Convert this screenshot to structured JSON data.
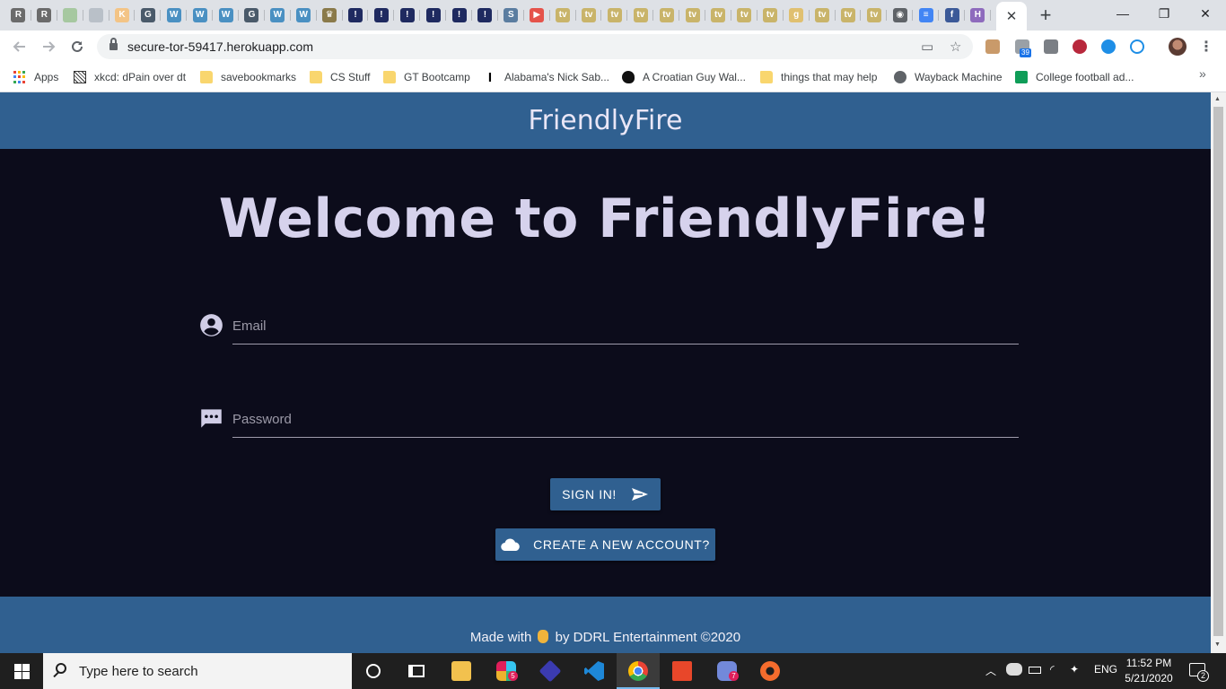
{
  "browser": {
    "tabs": [
      {
        "icon": "r-circle-icon",
        "glyph": "R",
        "color": "#6b6b6b"
      },
      {
        "icon": "r-circle-icon",
        "glyph": "R",
        "color": "#6b6b6b"
      },
      {
        "icon": "compass-icon",
        "glyph": "",
        "color": "#a6c8a0"
      },
      {
        "icon": "compass-icon",
        "glyph": "",
        "color": "#b9c0c8"
      },
      {
        "icon": "k-letter-icon",
        "glyph": "K",
        "color": "#f3c486"
      },
      {
        "icon": "g-circle-icon",
        "glyph": "G",
        "color": "#4a5a6a"
      },
      {
        "icon": "wordpress-icon",
        "glyph": "W",
        "color": "#4a90c2"
      },
      {
        "icon": "wordpress-icon",
        "glyph": "W",
        "color": "#4a90c2"
      },
      {
        "icon": "wordpress-icon",
        "glyph": "W",
        "color": "#4a90c2"
      },
      {
        "icon": "g-circle-icon",
        "glyph": "G",
        "color": "#4a5a6a"
      },
      {
        "icon": "wordpress-icon",
        "glyph": "W",
        "color": "#4a90c2"
      },
      {
        "icon": "wordpress-icon",
        "glyph": "W",
        "color": "#4a90c2"
      },
      {
        "icon": "crown-icon",
        "glyph": "♛",
        "color": "#8a7a4a"
      },
      {
        "icon": "exclamation-icon",
        "glyph": "!",
        "color": "#1f2a60"
      },
      {
        "icon": "exclamation-icon",
        "glyph": "!",
        "color": "#1f2a60"
      },
      {
        "icon": "exclamation-icon",
        "glyph": "!",
        "color": "#1f2a60"
      },
      {
        "icon": "exclamation-icon",
        "glyph": "!",
        "color": "#1f2a60"
      },
      {
        "icon": "exclamation-icon",
        "glyph": "!",
        "color": "#1f2a60"
      },
      {
        "icon": "exclamation-icon",
        "glyph": "!",
        "color": "#1f2a60"
      },
      {
        "icon": "s-circle-icon",
        "glyph": "S",
        "color": "#5b7da0"
      },
      {
        "icon": "youtube-icon",
        "glyph": "▶",
        "color": "#e5534b"
      },
      {
        "icon": "tv-icon",
        "glyph": "tv",
        "color": "#c9b46a"
      },
      {
        "icon": "tv-icon",
        "glyph": "tv",
        "color": "#c9b46a"
      },
      {
        "icon": "tv-icon",
        "glyph": "tv",
        "color": "#c9b46a"
      },
      {
        "icon": "tv-icon",
        "glyph": "tv",
        "color": "#c9b46a"
      },
      {
        "icon": "tv-icon",
        "glyph": "tv",
        "color": "#c9b46a"
      },
      {
        "icon": "tv-icon",
        "glyph": "tv",
        "color": "#c9b46a"
      },
      {
        "icon": "tv-icon",
        "glyph": "tv",
        "color": "#c9b46a"
      },
      {
        "icon": "tv-icon",
        "glyph": "tv",
        "color": "#c9b46a"
      },
      {
        "icon": "tv-icon",
        "glyph": "tv",
        "color": "#c9b46a"
      },
      {
        "icon": "g-letter-icon",
        "glyph": "g",
        "color": "#e0c070"
      },
      {
        "icon": "tv-icon",
        "glyph": "tv",
        "color": "#c9b46a"
      },
      {
        "icon": "tv-icon",
        "glyph": "tv",
        "color": "#c9b46a"
      },
      {
        "icon": "tv-icon",
        "glyph": "tv",
        "color": "#c9b46a"
      },
      {
        "icon": "globe-icon",
        "glyph": "◉",
        "color": "#5f6368"
      },
      {
        "icon": "docs-icon",
        "glyph": "≡",
        "color": "#4285f4"
      },
      {
        "icon": "facebook-icon",
        "glyph": "f",
        "color": "#3b5998"
      },
      {
        "icon": "heroku-icon",
        "glyph": "H",
        "color": "#8e6bbd"
      }
    ],
    "active_tab_close": "✕",
    "new_tab": "+",
    "window_controls": {
      "minimize": "—",
      "restore": "❐",
      "close": "✕"
    },
    "url": "secure-tor-59417.herokuapp.com",
    "extension_badge": "39",
    "bookmarks": [
      {
        "label": "Apps",
        "icon": "apps-grid-icon"
      },
      {
        "label": "xkcd: dPain over dt",
        "icon": "xkcd-icon"
      },
      {
        "label": "savebookmarks",
        "icon": "folder-icon"
      },
      {
        "label": "CS Stuff",
        "icon": "folder-icon"
      },
      {
        "label": "GT Bootcamp",
        "icon": "folder-icon"
      },
      {
        "label": "Alabama's Nick Sab...",
        "icon": "i-beam-icon"
      },
      {
        "label": "A Croatian Guy Wal...",
        "icon": "head-silhouette-icon"
      },
      {
        "label": "things that may help",
        "icon": "folder-icon"
      },
      {
        "label": "Wayback Machine",
        "icon": "globe-icon"
      },
      {
        "label": "College football ad...",
        "icon": "sheets-icon"
      }
    ],
    "bookmarks_overflow": "»"
  },
  "site": {
    "brand": "FriendlyFire",
    "welcome": "Welcome to FriendlyFire!",
    "email_placeholder": "Email",
    "password_placeholder": "Password",
    "sign_in_label": "SIGN IN!",
    "create_account_label": "CREATE A NEW ACCOUNT?",
    "footer_pre": "Made with",
    "footer_post": "by DDRL Entertainment ©2020",
    "colors": {
      "header": "#306090",
      "background": "#0c0c1b",
      "text": "#d6d2ec"
    }
  },
  "taskbar": {
    "search_placeholder": "Type here to search",
    "slack_badge": "5",
    "discord_badge": "7",
    "language": "ENG",
    "time": "11:52 PM",
    "date": "5/21/2020",
    "notifications": "2"
  }
}
